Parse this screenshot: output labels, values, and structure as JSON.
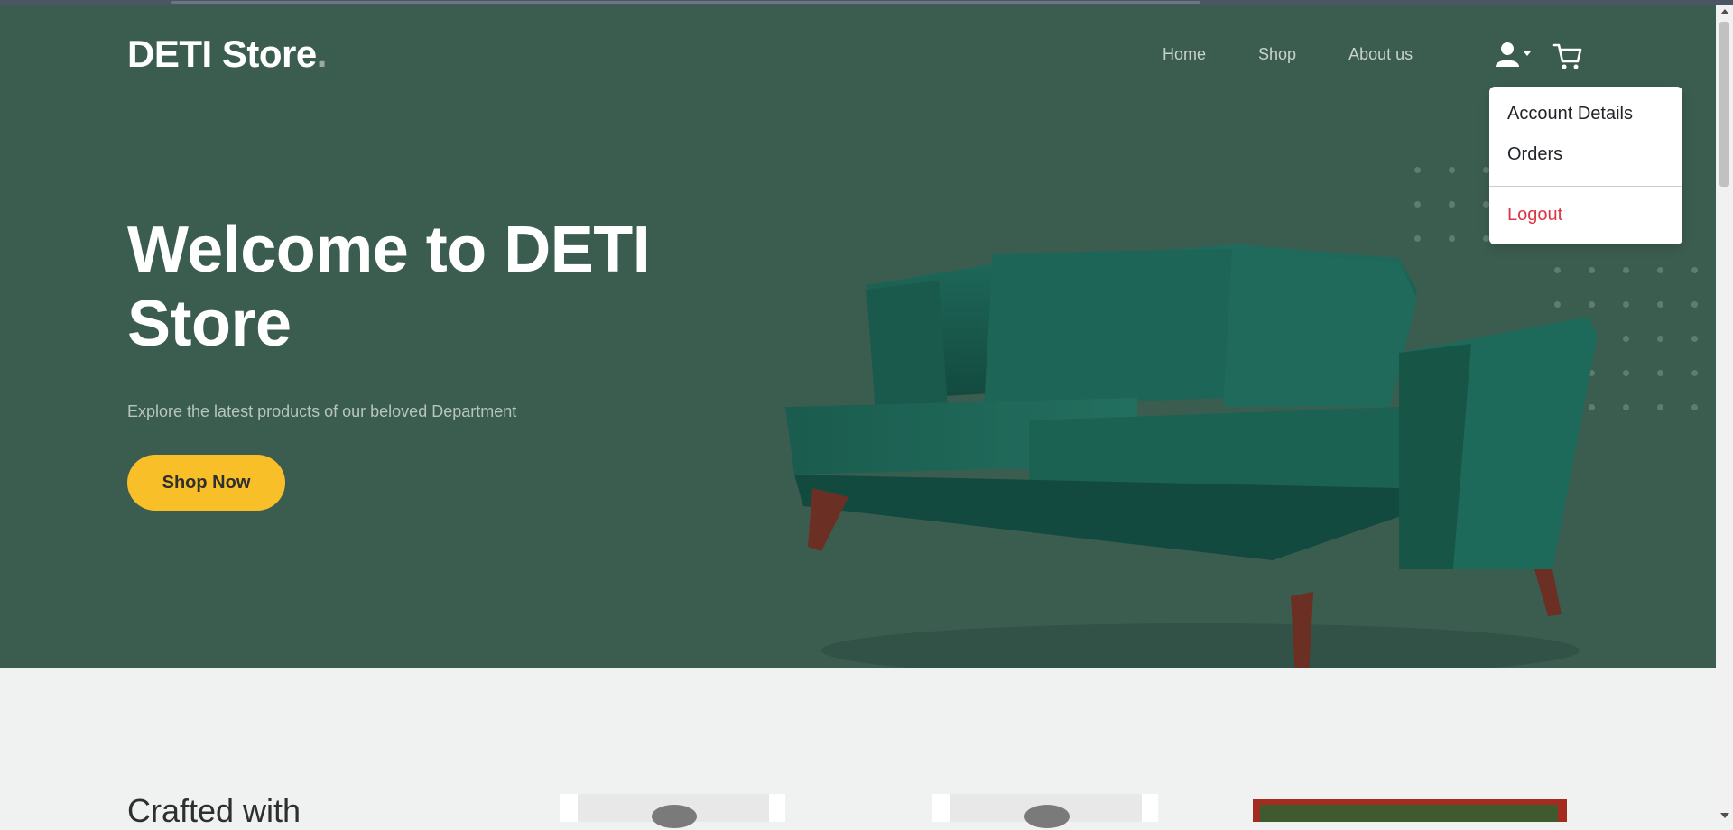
{
  "brand": {
    "name": "DETI Store",
    "dot": "."
  },
  "nav": {
    "items": [
      "Home",
      "Shop",
      "About us"
    ]
  },
  "icons": {
    "user": "user-icon",
    "caret": "caret-down-icon",
    "cart": "cart-icon"
  },
  "dropdown": {
    "account": "Account Details",
    "orders": "Orders",
    "logout": "Logout"
  },
  "hero": {
    "title": "Welcome to DETI Store",
    "subtitle": "Explore the latest products of our beloved Department",
    "cta": "Shop Now"
  },
  "section": {
    "heading": "Crafted with"
  },
  "colors": {
    "hero_bg": "#3b5d50",
    "accent": "#f9bf29",
    "logout": "#dc3545",
    "page_bg": "#eff2f1"
  }
}
